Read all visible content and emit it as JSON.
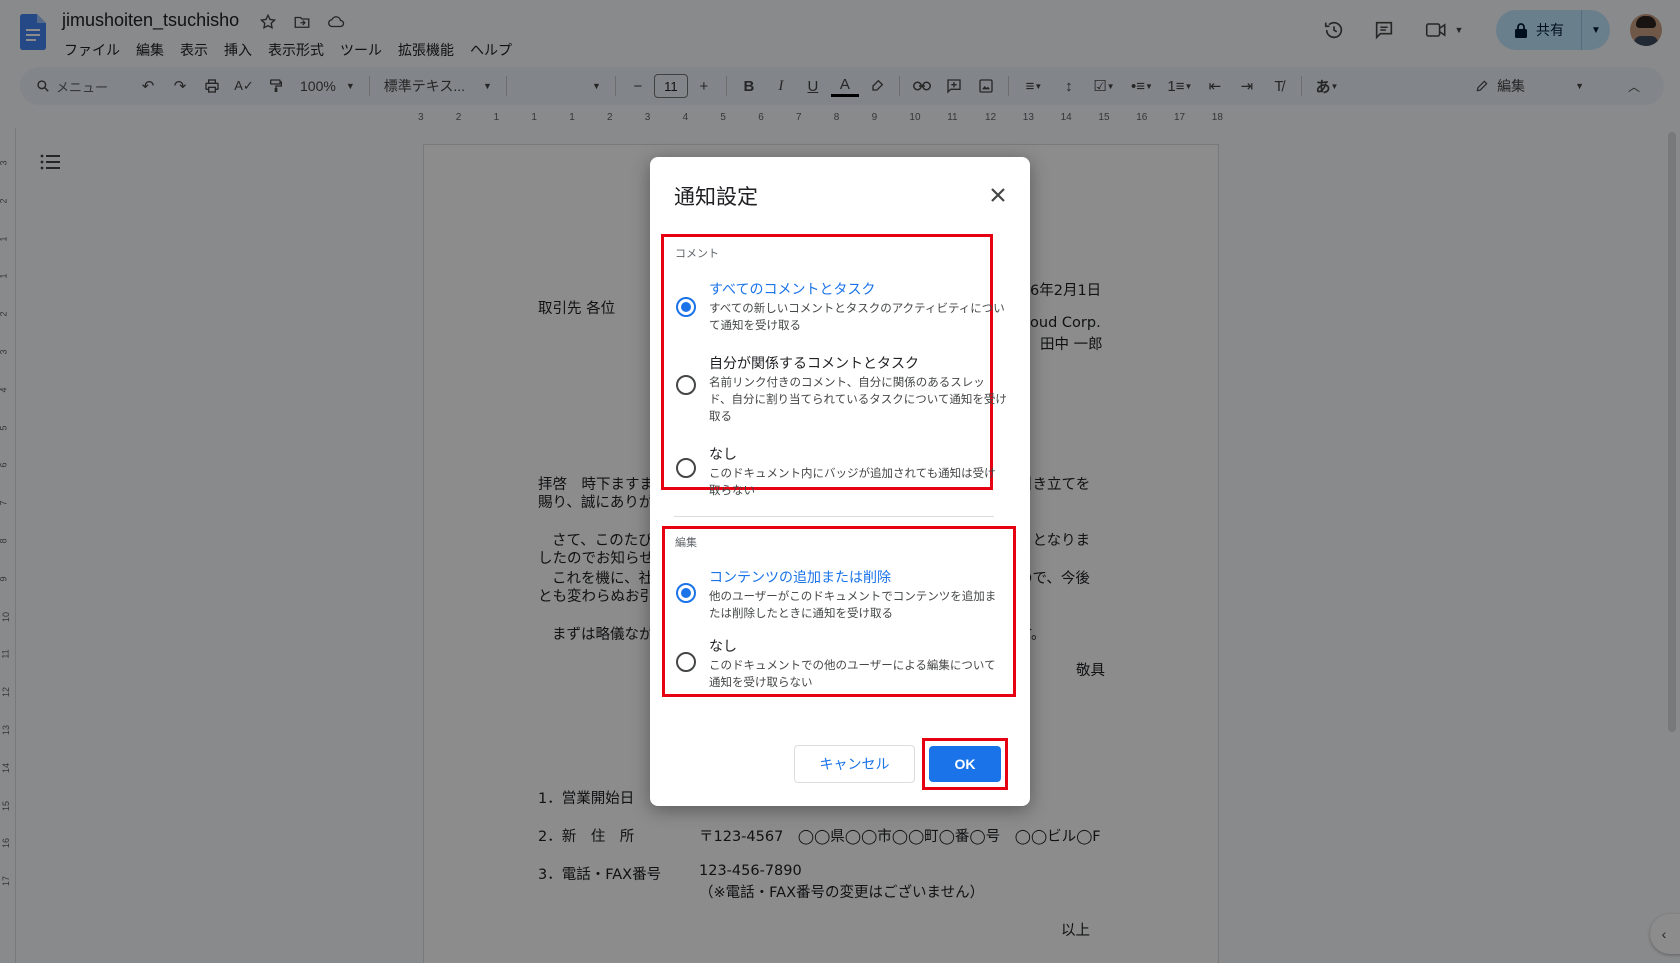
{
  "colors": {
    "accent": "#1a73e8",
    "highlight": "#e60012",
    "share_bg": "#c2e7ff"
  },
  "header": {
    "title": "jimushoiten_tsuchisho",
    "menu": [
      "ファイル",
      "編集",
      "表示",
      "挿入",
      "表示形式",
      "ツール",
      "拡張機能",
      "ヘルプ"
    ],
    "share_label": "共有"
  },
  "toolbar": {
    "search_placeholder": "メニュー",
    "zoom": "100%",
    "style": "標準テキス...",
    "font_size": "11",
    "edit_mode": "編集"
  },
  "ruler": {
    "labels": [
      "3",
      "2",
      "1",
      "1",
      "1",
      "2",
      "3",
      "4",
      "5",
      "6",
      "7",
      "8",
      "9",
      "10",
      "11",
      "12",
      "13",
      "14",
      "15",
      "16",
      "17",
      "18"
    ],
    "vlabels": [
      "3",
      "2",
      "1",
      "1",
      "2",
      "3",
      "4",
      "5",
      "6",
      "7",
      "8",
      "9",
      "10",
      "11",
      "12",
      "13",
      "14",
      "15",
      "16",
      "17"
    ]
  },
  "document": {
    "date": "6年2月1日",
    "recipient": "取引先 各位",
    "company": "loud Corp.",
    "sender": "田中 一郎",
    "p1_left_1": "拝啓　時下ますま",
    "p1_right_1": "引き立てを",
    "p1_left_2": "賜り、誠にありが",
    "p2_left_1": "さて、このたび",
    "p2_right_1": "ことなりま",
    "p2_left_2": "したのでお知らせ",
    "p2_left_3": "これを機に、社",
    "p2_right_3": "ので、今後",
    "p2_left_4": "とも変わらぬお引",
    "p3_left": "まずは略儀なが",
    "p3_right": "す。",
    "closing": "敬具",
    "item1": "1．営業開始日",
    "item2_label": "2．新　住　所",
    "item2_value": "〒123-4567　◯◯県◯◯市◯◯町◯番◯号　◯◯ビル◯F",
    "item3_label": "3．電話・FAX番号",
    "item3_value": "123-456-7890",
    "item3_note": "（※電話・FAX番号の変更はございません）",
    "end": "以上"
  },
  "dialog": {
    "title": "通知設定",
    "comments": {
      "label": "コメント",
      "options": [
        {
          "title": "すべてのコメントとタスク",
          "desc": "すべての新しいコメントとタスクのアクティビティについて通知を受け取る",
          "selected": true
        },
        {
          "title": "自分が関係するコメントとタスク",
          "desc": "名前リンク付きのコメント、自分に関係のあるスレッド、自分に割り当てられているタスクについて通知を受け取る",
          "selected": false
        },
        {
          "title": "なし",
          "desc": "このドキュメント内にバッジが追加されても通知は受け取らない",
          "selected": false
        }
      ]
    },
    "edits": {
      "label": "編集",
      "options": [
        {
          "title": "コンテンツの追加または削除",
          "desc": "他のユーザーがこのドキュメントでコンテンツを追加または削除したときに通知を受け取る",
          "selected": true
        },
        {
          "title": "なし",
          "desc": "このドキュメントでの他のユーザーによる編集について通知を受け取らない",
          "selected": false
        }
      ]
    },
    "cancel_label": "キャンセル",
    "ok_label": "OK"
  }
}
